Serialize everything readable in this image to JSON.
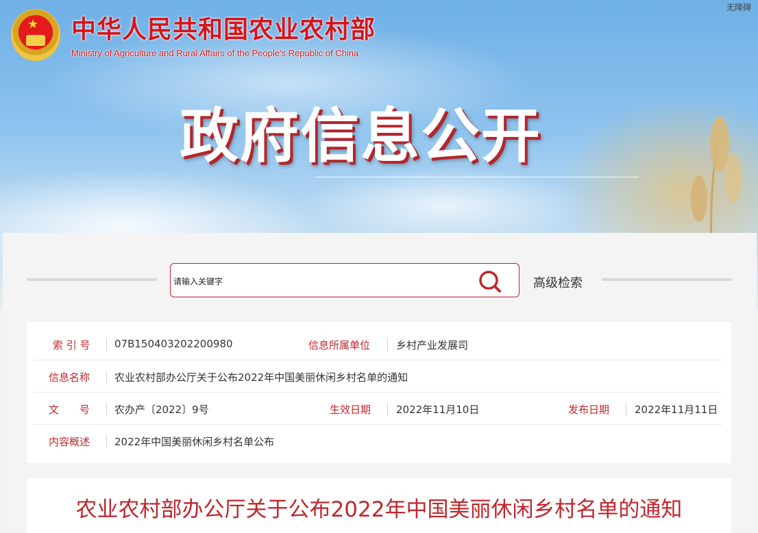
{
  "header": {
    "ministry_cn": "中华人民共和国农业农村部",
    "ministry_en": "Ministry of Agriculture and Rural Affairs of the People's Republic of China",
    "accessibility": "无障碍",
    "banner_title": "政府信息公开"
  },
  "search": {
    "value": "请输入关键字",
    "icon": "search-icon",
    "advanced_label": "高级检索"
  },
  "info": {
    "index_label": "索 引 号",
    "index_value": "07B150403202200980",
    "unit_label": "信息所属单位",
    "unit_value": "乡村产业发展司",
    "name_label": "信息名称",
    "name_value": "农业农村部办公厅关于公布2022年中国美丽休闲乡村名单的通知",
    "docno_label": "文　　号",
    "docno_value": "农办产〔2022〕9号",
    "effective_label": "生效日期",
    "effective_value": "2022年11月10日",
    "publish_label": "发布日期",
    "publish_value": "2022年11月11日",
    "summary_label": "内容概述",
    "summary_value": "2022年中国美丽休闲乡村名单公布"
  },
  "document": {
    "title": "农业农村部办公厅关于公布2022年中国美丽休闲乡村名单的通知"
  },
  "colors": {
    "accent": "#c0262c",
    "brand_red": "#d4151b"
  }
}
